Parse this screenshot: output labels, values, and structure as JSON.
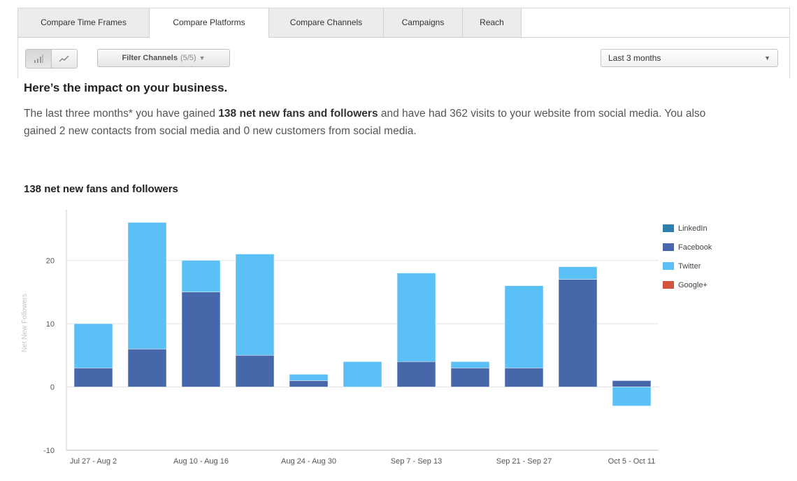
{
  "tabs": [
    {
      "label": "Compare Time Frames",
      "active": false
    },
    {
      "label": "Compare Platforms",
      "active": true
    },
    {
      "label": "Compare Channels",
      "active": false
    },
    {
      "label": "Campaigns",
      "active": false
    },
    {
      "label": "Reach",
      "active": false
    }
  ],
  "toolbar": {
    "view_buttons": [
      {
        "icon": "bar-chart-icon",
        "active": true
      },
      {
        "icon": "line-chart-icon",
        "active": false
      }
    ],
    "filter_label": "Filter Channels",
    "filter_count": "(5/5)",
    "filter_caret": "▼",
    "timeframe_value": "Last 3 months",
    "timeframe_arrow": "▼"
  },
  "content": {
    "headline": "Here’s the impact on your business.",
    "summary_part1": "The last three months* you have gained ",
    "summary_bold": "138 net new fans and followers",
    "summary_part2": " and have had 362 visits to your website from social media. You also gained 2 new contacts from social media and 0 new customers from social media.",
    "chart_title": "138 net new fans and followers"
  },
  "chart_data": {
    "type": "bar",
    "stacked": true,
    "ylabel": "Net New Followers",
    "ylim": [
      -10,
      28
    ],
    "yticks": [
      -10,
      0,
      10,
      20
    ],
    "grid": true,
    "legend_position": "right",
    "x_tick_labels": [
      "Jul 27 - Aug 2",
      "Aug 10 - Aug 16",
      "Aug 24 - Aug 30",
      "Sep 7 - Sep 13",
      "Sep 21 - Sep 27",
      "Oct 5 - Oct 11"
    ],
    "x_tick_indices": [
      0,
      2,
      4,
      6,
      8,
      10
    ],
    "category_count": 11,
    "series": [
      {
        "name": "LinkedIn",
        "color": "#2d7fb0",
        "values": [
          0,
          0,
          0,
          0,
          0,
          0,
          0,
          0,
          0,
          0,
          0
        ]
      },
      {
        "name": "Facebook",
        "color": "#4767ab",
        "values": [
          3,
          6,
          15,
          5,
          1,
          0,
          4,
          3,
          3,
          17,
          1
        ]
      },
      {
        "name": "Twitter",
        "color": "#5bc0f6",
        "values": [
          7,
          20,
          5,
          16,
          1,
          4,
          14,
          1,
          13,
          2,
          -3
        ]
      },
      {
        "name": "Google+",
        "color": "#d3543c",
        "values": [
          0,
          0,
          0,
          0,
          0,
          0,
          0,
          0,
          0,
          0,
          0
        ]
      }
    ]
  }
}
